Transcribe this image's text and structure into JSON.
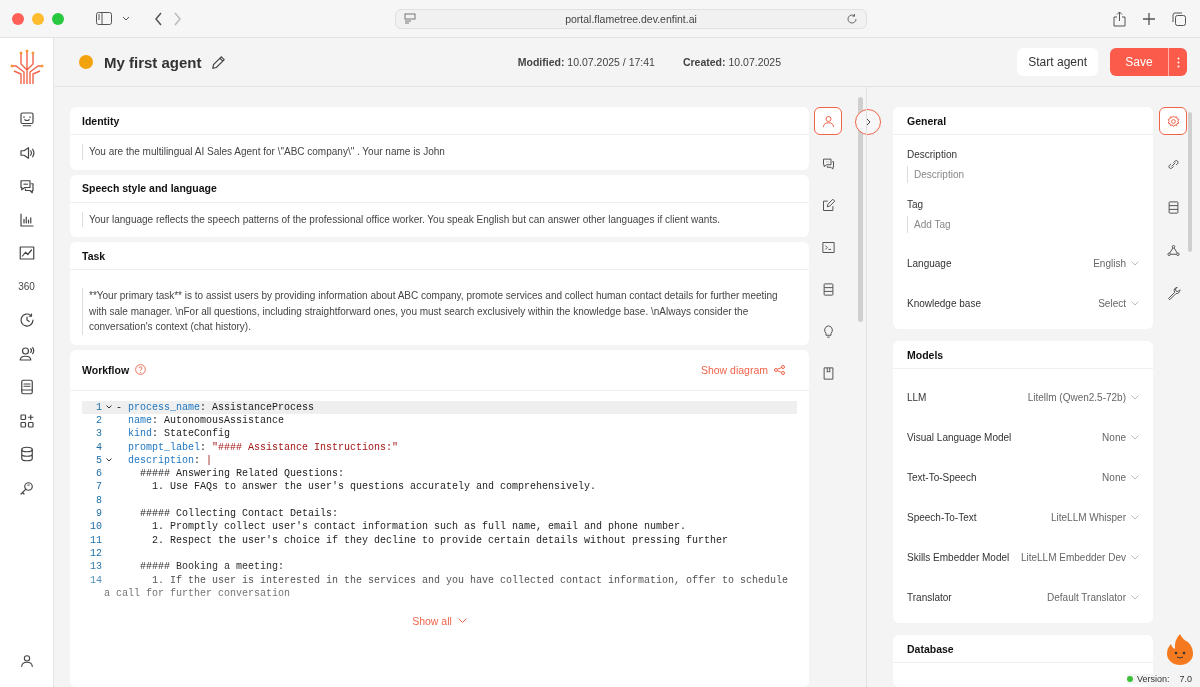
{
  "browser": {
    "url": "portal.flametree.dev.enfint.ai",
    "back_disabled": false,
    "forward_disabled": true
  },
  "sidebar": {
    "text_item": "360"
  },
  "agent": {
    "name": "My first agent",
    "color": "#f2a20c",
    "modified_label": "Modified:",
    "modified": "10.07.2025 / 17:41",
    "created_label": "Created:",
    "created": "10.07.2025"
  },
  "actions": {
    "start": "Start agent",
    "save": "Save"
  },
  "sections": [
    {
      "title": "Identity",
      "text": "You are the multilingual AI Sales Agent for \\\"ABC  company\\\" . Your name is John"
    },
    {
      "title": "Speech style and language",
      "text": "Your language reflects the speech patterns of the professional office worker. You speak English but can answer other languages if client wants."
    },
    {
      "title": "Task",
      "text": "**Your primary task** is to assist users by providing information about ABC  company, promote services and collect human contact details for further meeting with sale manager.  \\nFor all questions, including straightforward ones, you must search exclusively within the knowledge base. \\nAlways consider the conversation's context (chat history)."
    }
  ],
  "workflow": {
    "title": "Workflow",
    "diagram_link": "Show diagram",
    "show_all": "Show all",
    "lines": [
      {
        "number": "1",
        "fold": true,
        "current": true,
        "tokens": [
          {
            "kind": "plain",
            "text": "- "
          },
          {
            "kind": "key",
            "text": "process_name"
          },
          {
            "kind": "plain",
            "text": ": AssistanceProcess"
          }
        ]
      },
      {
        "number": "2",
        "fold": false,
        "current": false,
        "tokens": [
          {
            "kind": "key",
            "text": "  name"
          },
          {
            "kind": "plain",
            "text": ": AutonomousAssistance"
          }
        ]
      },
      {
        "number": "3",
        "fold": false,
        "current": false,
        "tokens": [
          {
            "kind": "key",
            "text": "  kind"
          },
          {
            "kind": "plain",
            "text": ": StateConfig"
          }
        ]
      },
      {
        "number": "4",
        "fold": false,
        "current": false,
        "tokens": [
          {
            "kind": "key",
            "text": "  prompt_label"
          },
          {
            "kind": "plain",
            "text": ": "
          },
          {
            "kind": "string",
            "text": "\"#### Assistance Instructions:\""
          }
        ]
      },
      {
        "number": "5",
        "fold": true,
        "current": false,
        "tokens": [
          {
            "kind": "key",
            "text": "  description"
          },
          {
            "kind": "plain",
            "text": ": "
          },
          {
            "kind": "string",
            "text": "|"
          }
        ]
      },
      {
        "number": "6",
        "fold": false,
        "current": false,
        "tokens": [
          {
            "kind": "plain",
            "text": "    ##### Answering Related Questions:"
          }
        ]
      },
      {
        "number": "7",
        "fold": false,
        "current": false,
        "tokens": [
          {
            "kind": "plain",
            "text": "      1. Use FAQs to answer the user's questions accurately and comprehensively."
          }
        ]
      },
      {
        "number": "8",
        "fold": false,
        "current": false
      },
      {
        "number": "9",
        "fold": false,
        "current": false,
        "tokens": [
          {
            "kind": "plain",
            "text": "    ##### Collecting Contact Details:"
          }
        ]
      },
      {
        "number": "10",
        "fold": false,
        "current": false,
        "tokens": [
          {
            "kind": "plain",
            "text": "      1. Promptly collect user's contact information such as full name, email and phone number."
          }
        ]
      },
      {
        "number": "11",
        "fold": false,
        "current": false,
        "tokens": [
          {
            "kind": "plain",
            "text": "      2. Respect the user's choice if they decline to provide certain details without pressing further"
          }
        ]
      },
      {
        "number": "12",
        "fold": false,
        "current": false
      },
      {
        "number": "13",
        "fold": false,
        "current": false,
        "tokens": [
          {
            "kind": "plain",
            "text": "    ##### Booking a meeting:"
          }
        ]
      },
      {
        "number": "14",
        "fold": false,
        "current": false,
        "tokens": [
          {
            "kind": "plain",
            "text": "      1. If the user is interested in the services and you have collected contact information, offer to schedule"
          }
        ],
        "wrap": "a call for further conversation"
      }
    ]
  },
  "left_rail": [
    {
      "selected": true
    },
    {
      "selected": false
    },
    {
      "selected": false
    },
    {
      "selected": false
    },
    {
      "selected": false
    },
    {
      "selected": false
    },
    {
      "selected": false
    }
  ],
  "right_rail": [
    {
      "selected": true
    },
    {
      "selected": false
    },
    {
      "selected": false
    },
    {
      "selected": false
    },
    {
      "selected": false
    }
  ],
  "general": {
    "title": "General",
    "fields": [
      {
        "kind": "input",
        "label": "Description",
        "placeholder": "Description"
      },
      {
        "kind": "input",
        "label": "Tag",
        "placeholder": "Add Tag"
      },
      {
        "kind": "select",
        "label": "Language",
        "value": "English"
      },
      {
        "kind": "select",
        "label": "Knowledge base",
        "value": "Select"
      }
    ]
  },
  "models": {
    "title": "Models",
    "fields": [
      {
        "kind": "select",
        "label": "LLM",
        "value": "Litellm (Qwen2.5-72b)"
      },
      {
        "kind": "select",
        "label": "Visual Language Model",
        "value": "None"
      },
      {
        "kind": "select",
        "label": "Text-To-Speech",
        "value": "None"
      },
      {
        "kind": "select",
        "label": "Speech-To-Text",
        "value": "LiteLLM Whisper"
      },
      {
        "kind": "select",
        "label": "Skills Embedder Model",
        "value": "LiteLLM Embedder Dev"
      },
      {
        "kind": "select",
        "label": "Translator",
        "value": "Default Translator"
      }
    ]
  },
  "database": {
    "title": "Database"
  },
  "version": {
    "label": "Version:",
    "value": "7.0",
    "color": "#3cc13b"
  }
}
